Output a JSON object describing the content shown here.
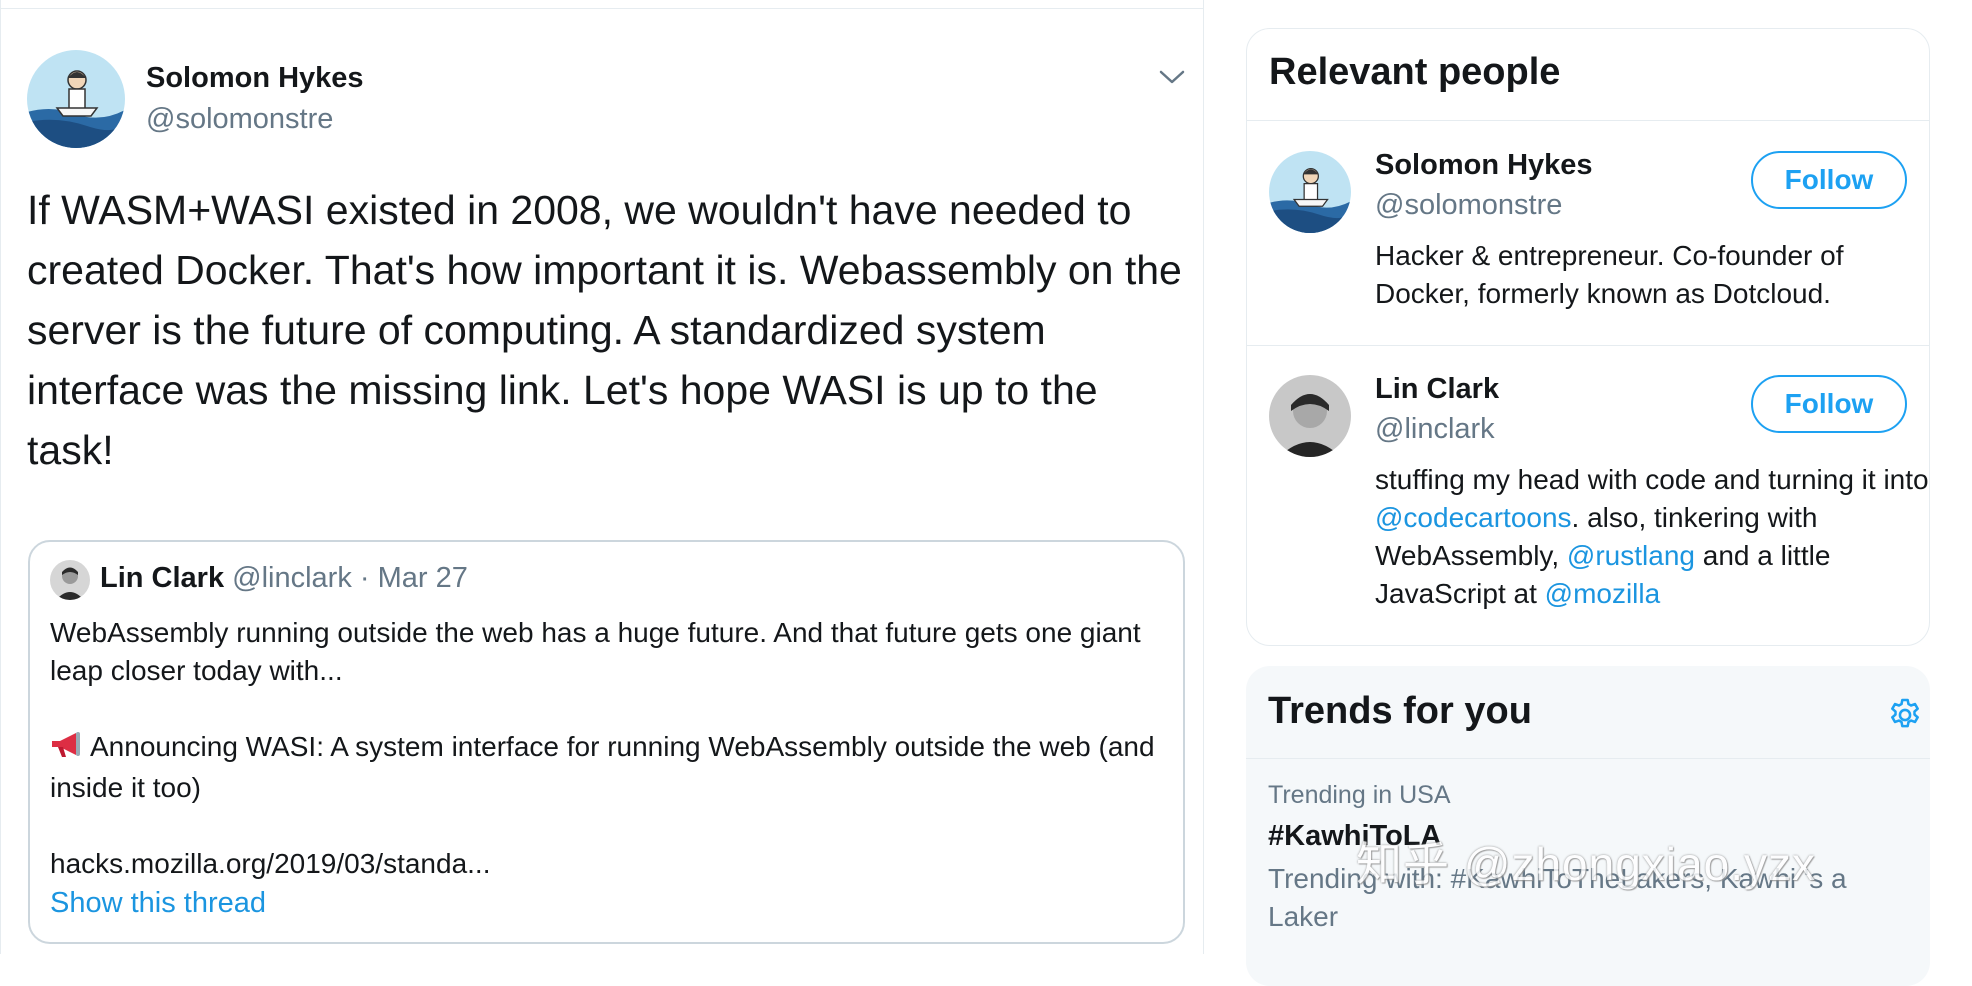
{
  "tweet": {
    "author": {
      "name": "Solomon Hykes",
      "handle": "@solomonstre"
    },
    "text": "If WASM+WASI existed in 2008, we wouldn't have needed to created Docker. That's how important it is. Webassembly on the server is the future of computing. A standardized system interface was the missing link. Let's hope WASI is up to the task!",
    "caret_icon": "chevron-down-icon",
    "quote": {
      "name": "Lin Clark",
      "meta": "@linclark · Mar 27",
      "line1": "WebAssembly running outside the web has a huge future. And that future gets one giant leap closer today with...",
      "line2": "Announcing WASI: A system interface for running WebAssembly outside the web (and inside it too)",
      "line3": "hacks.mozilla.org/2019/03/standa...",
      "show_thread": "Show this thread",
      "megaphone_icon": "megaphone-icon"
    }
  },
  "relevant_people": {
    "title": "Relevant people",
    "people": [
      {
        "name": "Solomon Hykes",
        "handle": "@solomonstre",
        "follow": "Follow",
        "bio": "Hacker & entrepreneur. Co-founder of Docker, formerly known as Dotcloud."
      },
      {
        "name": "Lin Clark",
        "handle": "@linclark",
        "follow": "Follow",
        "bio_parts": {
          "t1": "stuffing my head with code and turning it into ",
          "l1": "@codecartoons",
          "t2": ". also, tinkering with WebAssembly, ",
          "l2": "@rustlang",
          "t3": " and a little JavaScript at ",
          "l3": "@mozilla"
        }
      }
    ]
  },
  "trends": {
    "title": "Trends for you",
    "settings_icon": "gear-icon",
    "items": [
      {
        "context": "Trending in USA",
        "name": "#KawhiToLA",
        "description": "Trending with: #KawhiToTheLakers, Kawhi 's a Laker"
      }
    ]
  },
  "watermark": "知乎 @zhongxiao.yzx",
  "colors": {
    "accent": "#1da1f2",
    "link": "#1b95e0",
    "secondary_text": "#657786",
    "border": "#e6ecf0"
  }
}
